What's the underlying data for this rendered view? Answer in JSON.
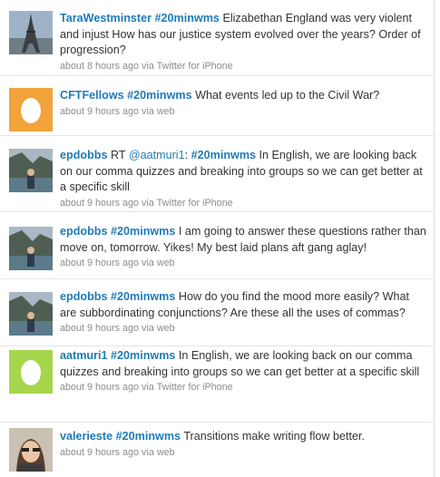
{
  "tweets": [
    {
      "user": "TaraWestminster",
      "hashtag": "#20minwms",
      "text": "Elizabethan England was very violent and injust How has our justice system evolved over the years? Order of progression?",
      "time": "about 8 hours ago",
      "via": "via",
      "source": "Twitter for iPhone",
      "avatar": "eiffel-tower"
    },
    {
      "user": "CFTFellows",
      "hashtag": "#20minwms",
      "text": "What events led up to the Civil War?",
      "time": "about 9 hours ago",
      "via": "via",
      "source": "web",
      "avatar": "default-egg-orange"
    },
    {
      "user": "epdobbs",
      "prefix": "RT",
      "rt_user": "@aatmuri1",
      "hashtag": "#20minwms",
      "text": "In English, we are looking back on our comma quizzes and breaking into groups so we can get better at a specific skill",
      "time": "about 9 hours ago",
      "via": "via",
      "source": "Twitter for iPhone",
      "avatar": "fjord-photo"
    },
    {
      "user": "epdobbs",
      "hashtag": "#20minwms",
      "text": "I am going to answer these questions rather than move on, tomorrow. Yikes! My best laid plans aft gang aglay!",
      "time": "about 9 hours ago",
      "via": "via",
      "source": "web",
      "avatar": "fjord-photo"
    },
    {
      "user": "epdobbs",
      "hashtag": "#20minwms",
      "text": "How do you find the mood more easily? What are subbordinating conjunctions? Are these all the uses of commas?",
      "time": "about 9 hours ago",
      "via": "via",
      "source": "web",
      "avatar": "fjord-photo"
    },
    {
      "user": "aatmuri1",
      "hashtag": "#20minwms",
      "text": "In English, we are looking back on our comma quizzes and breaking into groups so we can get better at a specific skill",
      "time": "about 9 hours ago",
      "via": "via",
      "source": "Twitter for iPhone",
      "avatar": "default-egg-green"
    },
    {
      "user": "valerieste",
      "hashtag": "#20minwms",
      "text": "Transitions make writing flow better.",
      "time": "about 9 hours ago",
      "via": "via",
      "source": "web",
      "avatar": "person-photo"
    }
  ],
  "colors": {
    "link": "#1f7bb6",
    "meta": "#8c8c8c",
    "egg_orange": "#f2a33a",
    "egg_green": "#a6d64b"
  }
}
